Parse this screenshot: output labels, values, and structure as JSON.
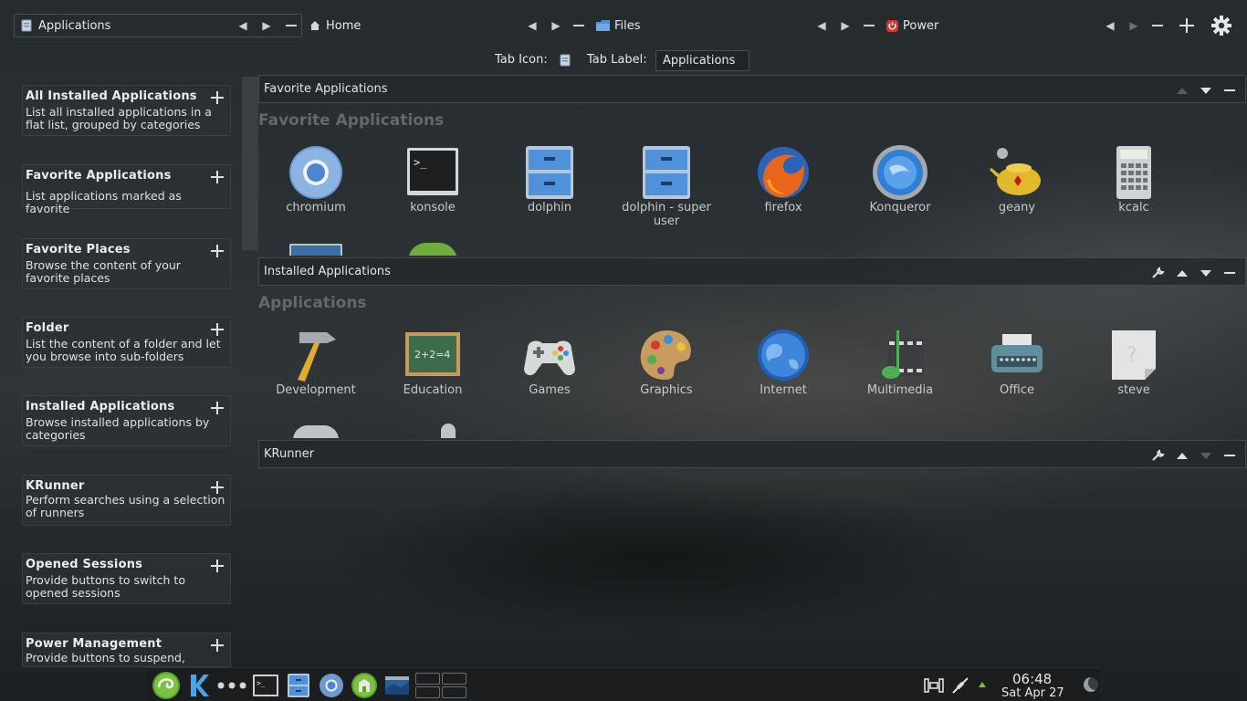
{
  "tabs": [
    {
      "label": "Applications",
      "icon": "applications-icon"
    },
    {
      "label": "Home",
      "icon": "home-icon"
    },
    {
      "label": "Files",
      "icon": "folder-icon"
    },
    {
      "label": "Power",
      "icon": "power-icon"
    }
  ],
  "tab_settings": {
    "icon_label": "Tab Icon:",
    "label_label": "Tab Label:",
    "label_value": "Applications"
  },
  "widgets": [
    {
      "title": "All Installed Applications",
      "desc": "List all installed applications in a flat list, grouped by categories"
    },
    {
      "title": "Favorite Applications",
      "desc": "List applications marked as favorite"
    },
    {
      "title": "Favorite Places",
      "desc": "Browse the content of your favorite places"
    },
    {
      "title": "Folder",
      "desc": "List the content of a folder and let you browse into sub-folders"
    },
    {
      "title": "Installed Applications",
      "desc": "Browse installed applications by categories"
    },
    {
      "title": "KRunner",
      "desc": "Perform searches using a selection of runners"
    },
    {
      "title": "Opened Sessions",
      "desc": "Provide buttons to switch to opened sessions"
    },
    {
      "title": "Power Management",
      "desc": "Provide buttons to suspend,"
    }
  ],
  "sections": {
    "favorites": {
      "header": "Favorite Applications",
      "label": "Favorite Applications",
      "apps": [
        "chromium",
        "konsole",
        "dolphin",
        "dolphin - super user",
        "firefox",
        "Konqueror",
        "geany",
        "kcalc"
      ]
    },
    "installed": {
      "header": "Installed Applications",
      "label": "Applications",
      "apps": [
        "Development",
        "Education",
        "Games",
        "Graphics",
        "Internet",
        "Multimedia",
        "Office",
        "steve"
      ]
    },
    "krunner": {
      "header": "KRunner"
    }
  },
  "clock": {
    "time": "06:48",
    "date": "Sat Apr 27"
  },
  "colors": {
    "accent": "#7cc242",
    "power_red": "#d9342b"
  }
}
